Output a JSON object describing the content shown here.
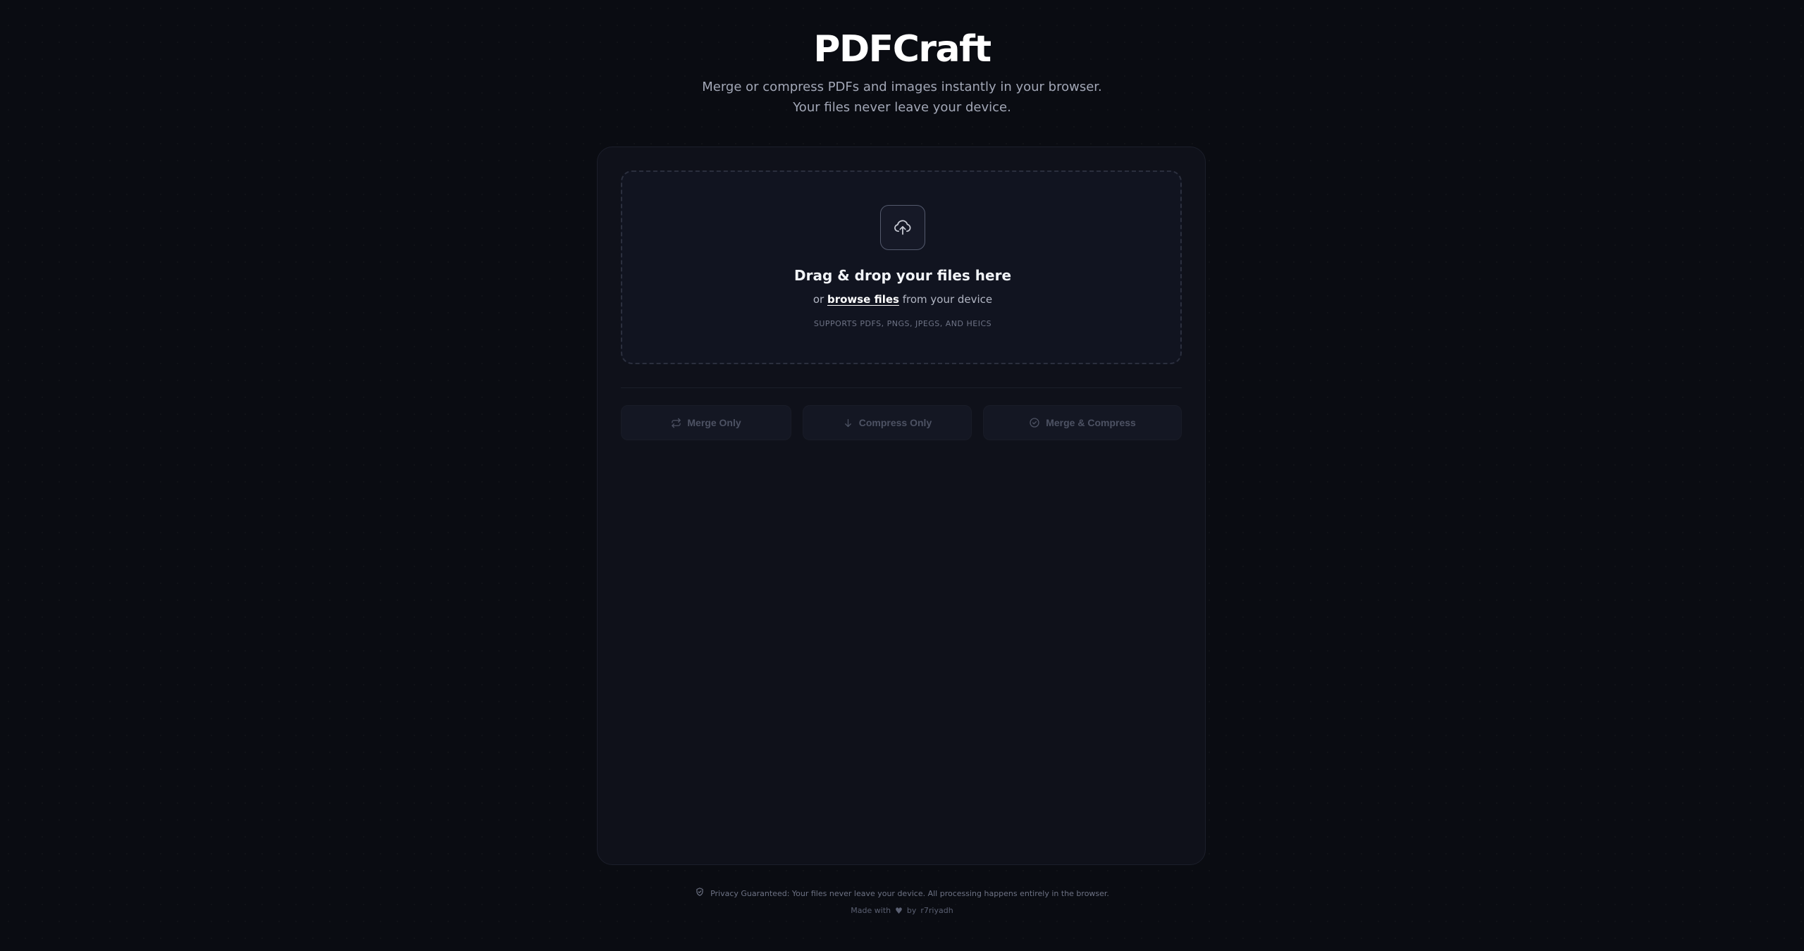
{
  "app": {
    "title": "PDFCraft",
    "tagline_line1": "Merge or compress PDFs and images instantly in your browser.",
    "tagline_line2": "Your files never leave your device."
  },
  "dropzone": {
    "icon": "cloud-upload-icon",
    "title": "Drag & drop your files here",
    "prefix": "or",
    "browse_label": "browse files",
    "suffix": "from your device",
    "supported": "SUPPORTS PDFS, PNGS, JPEGS, AND HEICS"
  },
  "actions": [
    {
      "label": "Merge Only",
      "icon": "merge-arrows-icon",
      "enabled": false
    },
    {
      "label": "Compress Only",
      "icon": "arrow-down-icon",
      "enabled": false
    },
    {
      "label": "Merge & Compress",
      "icon": "check-circle-icon",
      "enabled": false
    }
  ],
  "footer": {
    "privacy_icon": "shield-check-icon",
    "privacy_text": "Privacy Guaranteed: Your files never leave your device. All processing happens entirely in the browser.",
    "made_with": "Made with",
    "heart_glyph": "♥",
    "by_text": "by",
    "author": "r7riyadh"
  },
  "colors": {
    "background": "#0a0c12",
    "card": "#0f111a",
    "dropzone": "#111420",
    "muted_text": "#6d7284",
    "disabled_button_text": "#4d5263"
  }
}
